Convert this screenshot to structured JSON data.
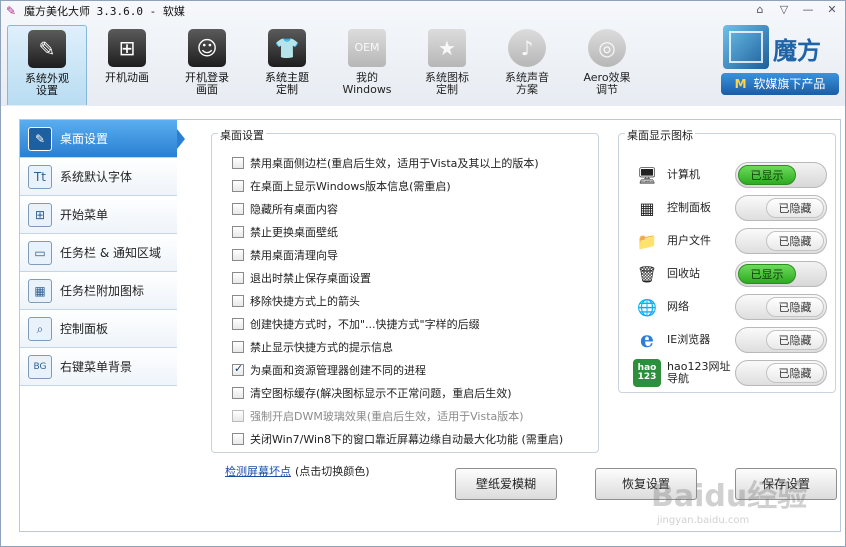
{
  "window": {
    "title": "魔方美化大师 3.3.6.0 - 软媒",
    "controls": [
      "⌂",
      "▽",
      "—",
      "✕"
    ]
  },
  "toolbar": [
    {
      "label": "系统外观\n设置",
      "icon": "✎",
      "active": true
    },
    {
      "label": "开机动画",
      "icon": "⊞",
      "active": false
    },
    {
      "label": "开机登录\n画面",
      "icon": "☺",
      "active": false
    },
    {
      "label": "系统主题\n定制",
      "icon": "👕",
      "active": false
    },
    {
      "label": "我的\nWindows",
      "icon": "OEM",
      "active": false,
      "dim": true
    },
    {
      "label": "系统图标\n定制",
      "icon": "★",
      "active": false,
      "dim": true
    },
    {
      "label": "系统声音\n方案",
      "icon": "♪",
      "active": false,
      "dim": true
    },
    {
      "label": "Aero效果\n调节",
      "icon": "◎",
      "active": false,
      "dim": true
    }
  ],
  "brand": {
    "name": "魔方",
    "button_m": "M",
    "button_label": "软媒旗下产品"
  },
  "sidebar": [
    {
      "label": "桌面设置",
      "icon": "✎",
      "active": true
    },
    {
      "label": "系统默认字体",
      "icon": "Tt"
    },
    {
      "label": "开始菜单",
      "icon": "⊞"
    },
    {
      "label": "任务栏 & 通知区域",
      "icon": "▭"
    },
    {
      "label": "任务栏附加图标",
      "icon": "▦"
    },
    {
      "label": "控制面板",
      "icon": "⌕"
    },
    {
      "label": "右键菜单背景",
      "icon": "BG"
    }
  ],
  "desktop_settings": {
    "title": "桌面设置",
    "options": [
      {
        "label": "禁用桌面侧边栏(重启后生效，适用于Vista及其以上的版本)",
        "checked": false
      },
      {
        "label": "在桌面上显示Windows版本信息(需重启)",
        "checked": false
      },
      {
        "label": "隐藏所有桌面内容",
        "checked": false
      },
      {
        "label": "禁止更换桌面壁纸",
        "checked": false
      },
      {
        "label": "禁用桌面清理向导",
        "checked": false
      },
      {
        "label": "退出时禁止保存桌面设置",
        "checked": false
      },
      {
        "label": "移除快捷方式上的箭头",
        "checked": false
      },
      {
        "label": "创建快捷方式时，不加\"...快捷方式\"字样的后缀",
        "checked": false
      },
      {
        "label": "禁止显示快捷方式的提示信息",
        "checked": false
      },
      {
        "label": "为桌面和资源管理器创建不同的进程",
        "checked": true
      },
      {
        "label": "清空图标缓存(解决图标显示不正常问题，重启后生效)",
        "checked": false
      },
      {
        "label": "强制开启DWM玻璃效果(重启后生效，适用于Vista版本)",
        "checked": false,
        "disabled": true
      },
      {
        "label": "关闭Win7/Win8下的窗口靠近屏幕边缘自动最大化功能 (需重启)",
        "checked": false
      }
    ]
  },
  "desktop_icons": {
    "title": "桌面显示图标",
    "items": [
      {
        "label": "计算机",
        "icon": "🖥",
        "state": "已显示",
        "on": true,
        "color": "#3a7fc6"
      },
      {
        "label": "控制面板",
        "icon": "▦",
        "state": "已隐藏",
        "on": false,
        "color": "#5b8fd0"
      },
      {
        "label": "用户文件",
        "icon": "📁",
        "state": "已隐藏",
        "on": false,
        "color": "#d9a341"
      },
      {
        "label": "回收站",
        "icon": "🗑",
        "state": "已显示",
        "on": true,
        "color": "#7fb2d8"
      },
      {
        "label": "网络",
        "icon": "🌐",
        "state": "已隐藏",
        "on": false,
        "color": "#3b9a45"
      },
      {
        "label": "IE浏览器",
        "icon": "e",
        "state": "已隐藏",
        "on": false,
        "color": "#2c7fd8"
      },
      {
        "label": "hao123网址\n导航",
        "icon": "hao\n123",
        "state": "已隐藏",
        "on": false,
        "color": "#2d8e3b"
      }
    ]
  },
  "footer": {
    "link": "检测屏幕坏点",
    "link_note": "(点击切换颜色)",
    "buttons": [
      "壁纸爱模糊",
      "恢复设置",
      "保存设置"
    ]
  },
  "watermark": {
    "main": "Baidu经验",
    "sub": "jingyan.baidu.com"
  }
}
